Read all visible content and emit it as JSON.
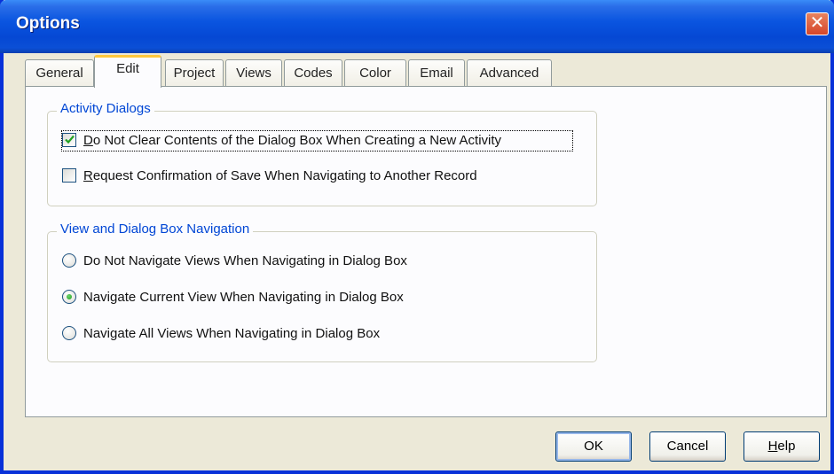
{
  "window": {
    "title": "Options",
    "close_label": "✕"
  },
  "tabs": [
    {
      "label": "General",
      "active": false
    },
    {
      "label": "Edit",
      "active": true
    },
    {
      "label": "Project",
      "active": false
    },
    {
      "label": "Views",
      "active": false
    },
    {
      "label": "Codes",
      "active": false
    },
    {
      "label": "Color",
      "active": false
    },
    {
      "label": "Email",
      "active": false
    },
    {
      "label": "Advanced",
      "active": false
    }
  ],
  "activity_dialogs": {
    "title": "Activity Dialogs",
    "options": [
      {
        "label_first": "D",
        "label_rest": "o Not Clear Contents of the Dialog Box When Creating a New Activity",
        "checked": true
      },
      {
        "label_first": "R",
        "label_rest": "equest Confirmation of Save When Navigating to Another Record",
        "checked": false
      }
    ]
  },
  "navigation": {
    "title": "View and Dialog Box Navigation",
    "options": [
      {
        "label": "Do Not Navigate Views When Navigating in Dialog Box",
        "selected": false
      },
      {
        "label": "Navigate Current View When Navigating in Dialog Box",
        "selected": true
      },
      {
        "label": "Navigate All Views When Navigating in Dialog Box",
        "selected": false
      }
    ]
  },
  "buttons": {
    "ok": "OK",
    "cancel": "Cancel",
    "help_first": "H",
    "help_rest": "elp"
  },
  "colors": {
    "title_bar": "#0a55e0",
    "accent_text": "#0046d5",
    "active_tab_highlight": "#ffc83c",
    "radio_selected": "#21a121",
    "checkmark": "#21a121"
  }
}
